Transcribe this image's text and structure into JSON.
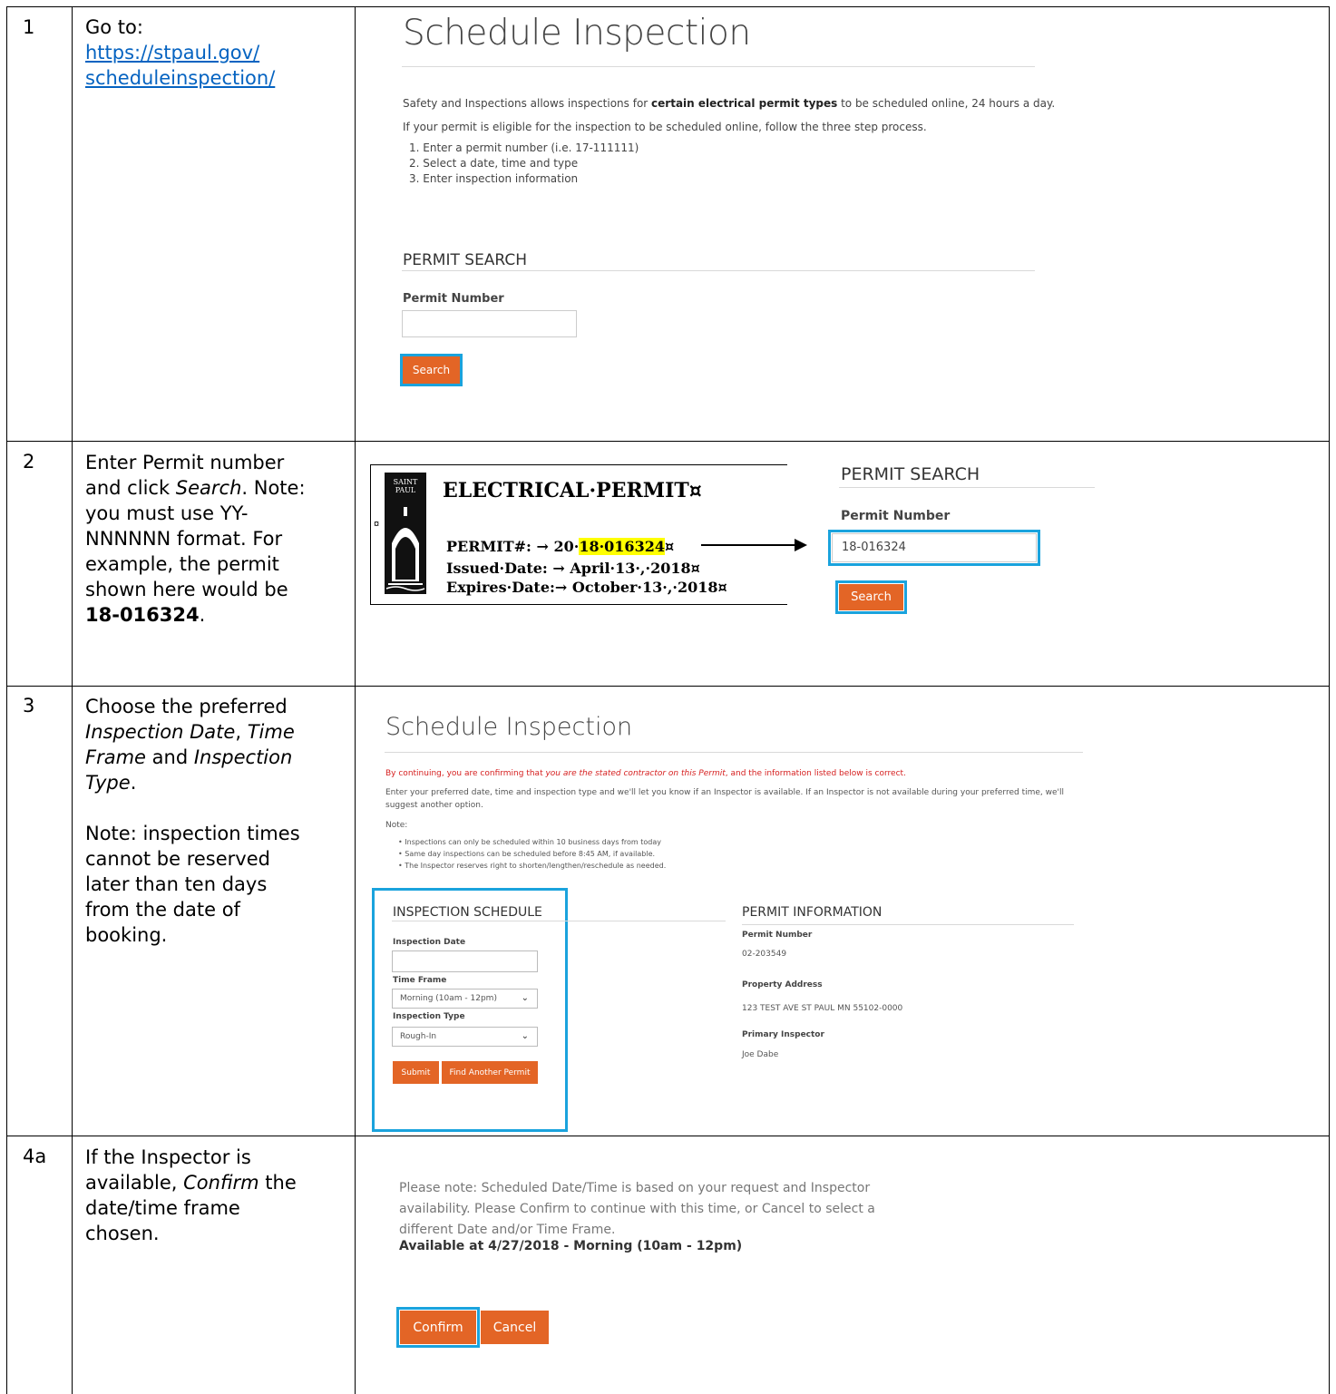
{
  "rows": [
    {
      "num": "1",
      "desc_prefix": "Go to:",
      "link_line1": "https://stpaul.gov/",
      "link_line2": "scheduleinspection/"
    },
    {
      "num": "2",
      "desc_line1": "Enter Permit number",
      "desc_line2_a": "and click ",
      "desc_line2_i": "Search",
      "desc_line2_b": ". Note:",
      "desc_line3": "you must use YY-",
      "desc_line4": "NNNNNN format. For",
      "desc_line5": "example, the permit",
      "desc_line6": "shown here would be",
      "desc_line7_b": "18-016324",
      "desc_line7_tail": "."
    },
    {
      "num": "3",
      "desc_line1": "Choose the preferred",
      "desc_line2_i1": "Inspection Date",
      "desc_line2_sep": ", ",
      "desc_line2_i2": "Time",
      "desc_line3_i": "Frame",
      "desc_line3_mid": " and ",
      "desc_line3_i2": "Inspection",
      "desc_line4_i": "Type",
      "desc_line4_tail": ".",
      "note_line1": "Note: inspection times",
      "note_line2": "cannot be reserved",
      "note_line3": "later than ten days",
      "note_line4": "from the date of",
      "note_line5": "booking."
    },
    {
      "num": "4a",
      "desc_line1": "If the Inspector is",
      "desc_line2_a": "available, ",
      "desc_line2_i": "Confirm",
      "desc_line2_b": " the",
      "desc_line3": "date/time frame",
      "desc_line4": "chosen."
    }
  ],
  "shot1": {
    "title": "Schedule Inspection",
    "intro_a": "Safety and Inspections allows inspections for ",
    "intro_b": "certain electrical permit types",
    "intro_c": " to be scheduled online, 24 hours a day.",
    "eligible": "If your permit is eligible for the inspection to be scheduled online, follow the three step process.",
    "steps": [
      "1.  Enter a permit number (i.e. 17-111111)",
      "2.  Select a date, time and type",
      "3.  Enter inspection information"
    ],
    "section": "PERMIT SEARCH",
    "field_label": "Permit Number",
    "field_value": "",
    "button": "Search"
  },
  "shot2": {
    "seal_text_1": "SAINT",
    "seal_text_2": "PAUL",
    "permit_title": "ELECTRICAL·PERMIT¤",
    "pilcrow": "¤",
    "permit_label": "PERMIT#:  →  20·",
    "permit_hl": "18·016324",
    "permit_end": "¤",
    "issued": "Issued·Date: → April·13·,·2018¤",
    "expires": "Expires·Date:→ October·13·,·2018¤",
    "section": "PERMIT SEARCH",
    "field_label": "Permit Number",
    "field_value": "18-016324",
    "button": "Search"
  },
  "shot3": {
    "title": "Schedule Inspection",
    "warn_a": "By continuing, you are confirming that ",
    "warn_i": "you are the stated contractor on this Permit",
    "warn_b": ", and the information listed below is correct.",
    "enter_1": "Enter your preferred date, time and inspection type and we'll let you know if an Inspector is available. If an Inspector is not available during your preferred time, we'll",
    "enter_2": "suggest another option.",
    "note": "Note:",
    "bullets": [
      "•  Inspections can only be scheduled within 10 business days from today",
      "•  Same day inspections can be scheduled before 8:45 AM, if available.",
      "•  The Inspector reserves right to shorten/lengthen/reschedule as needed."
    ],
    "sched_heading": "INSPECTION SCHEDULE",
    "date_label": "Inspection Date",
    "time_label": "Time Frame",
    "time_value": "Morning (10am - 12pm)",
    "type_label": "Inspection Type",
    "type_value": "Rough-In",
    "submit": "Submit",
    "find_another": "Find Another Permit",
    "info_heading": "PERMIT INFORMATION",
    "permit_number_label": "Permit Number",
    "permit_number": "02-203549",
    "address_label": "Property Address",
    "address": "123 TEST AVE ST PAUL MN 55102-0000",
    "inspector_label": "Primary Inspector",
    "inspector": "Joe Dabe"
  },
  "shot4": {
    "note_1": "Please note: Scheduled Date/Time is based on your request and Inspector",
    "note_2": "availability. Please Confirm to continue with this time, or Cancel to select a",
    "note_3": "different Date and/or Time Frame.",
    "available": "Available at 4/27/2018 - Morning (10am - 12pm)",
    "confirm": "Confirm",
    "cancel": "Cancel"
  },
  "colors": {
    "accent_orange": "#e36526",
    "highlight_blue": "#1aa3dd",
    "link_blue": "#0563c1",
    "warning_red": "#d62020"
  }
}
